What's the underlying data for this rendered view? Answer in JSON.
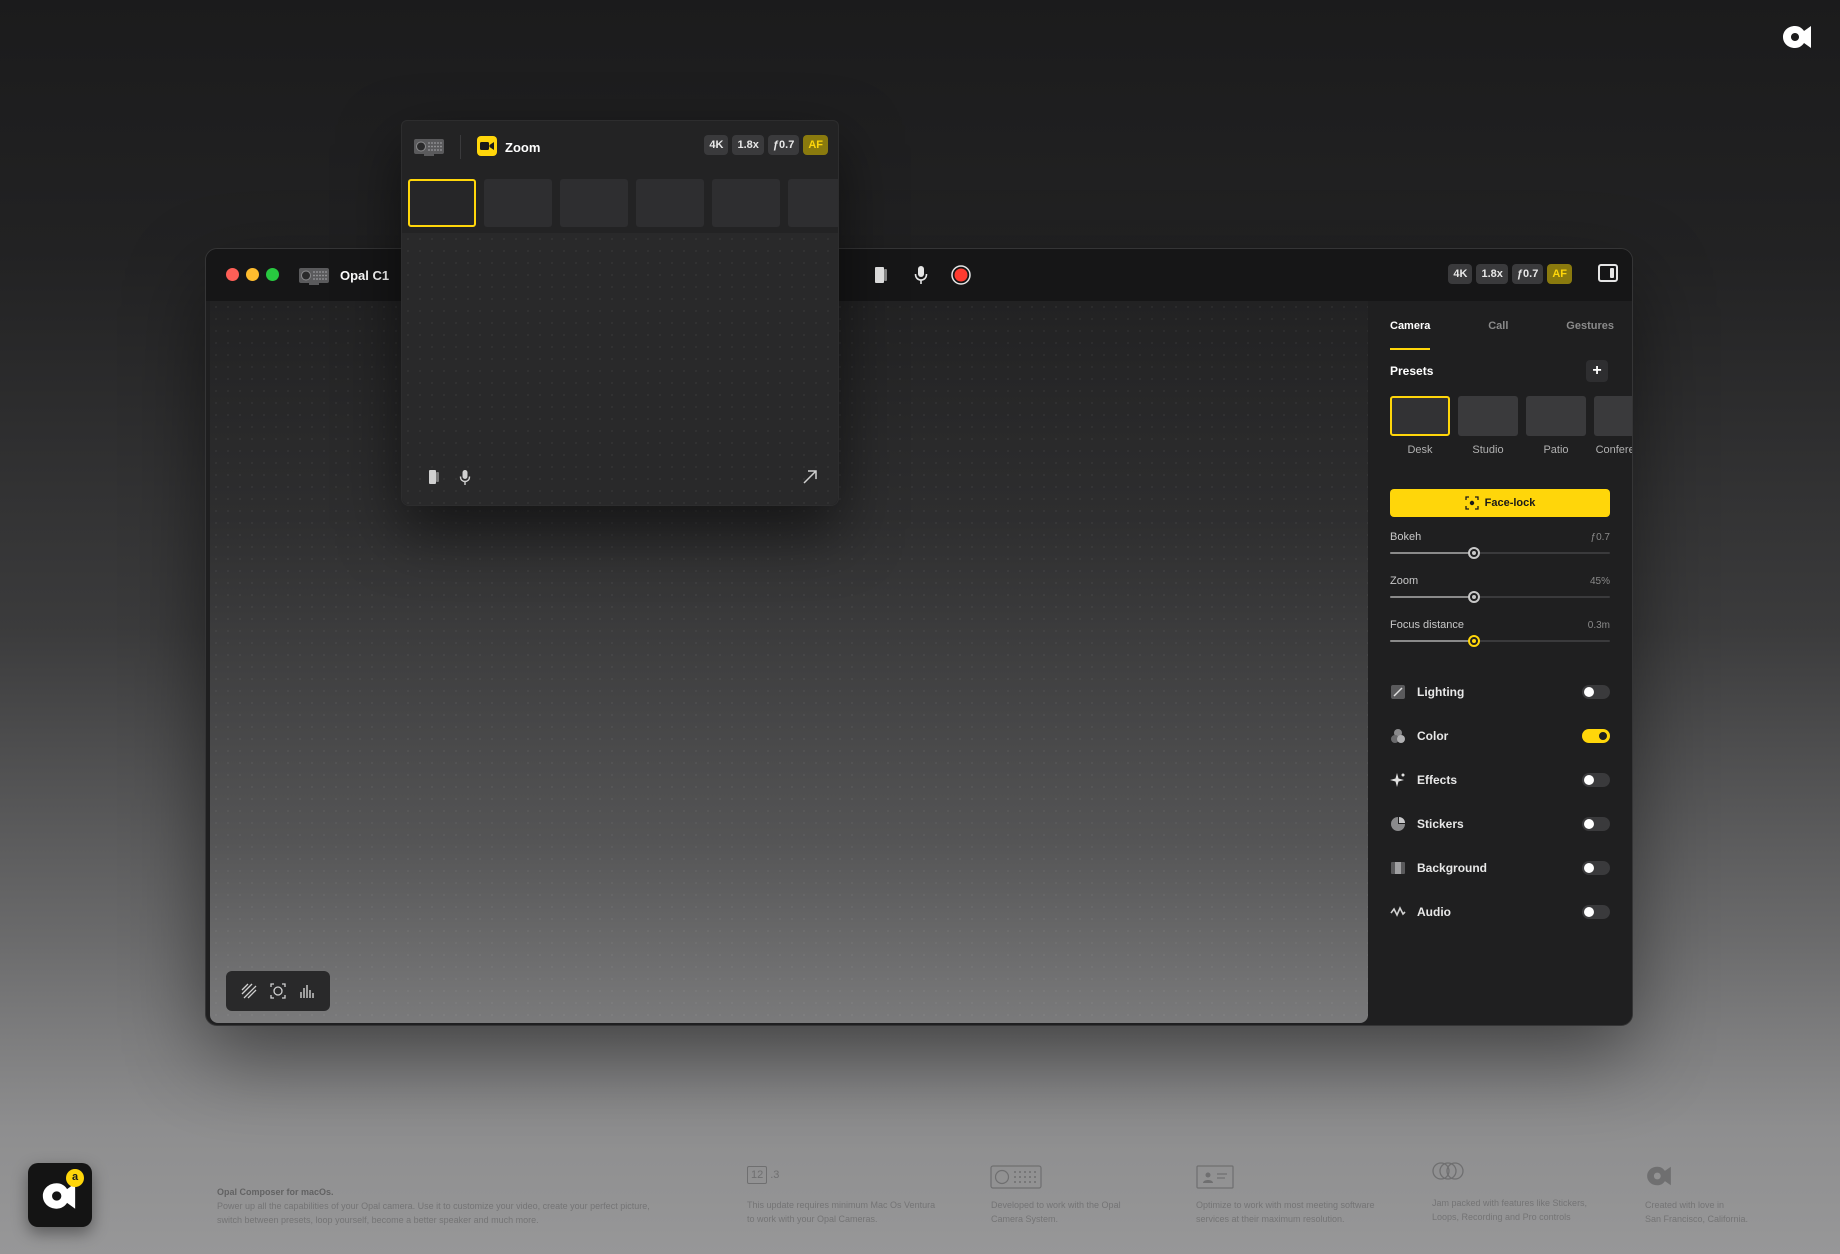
{
  "window": {
    "title": "Opal C1",
    "badges": [
      "4K",
      "1.8x",
      "ƒ0.7",
      "AF"
    ]
  },
  "popup": {
    "title": "Zoom",
    "badges": [
      "4K",
      "1.8x",
      "ƒ0.7",
      "AF"
    ],
    "preset_count": 6
  },
  "sidebar": {
    "tabs": [
      {
        "label": "Camera",
        "active": true
      },
      {
        "label": "Call",
        "active": false
      },
      {
        "label": "Gestures",
        "active": false
      }
    ],
    "presets_label": "Presets",
    "add_label": "+",
    "presets": [
      {
        "name": "Desk",
        "active": true
      },
      {
        "name": "Studio",
        "active": false
      },
      {
        "name": "Patio",
        "active": false
      },
      {
        "name": "Conference",
        "active": false
      }
    ],
    "facelock_label": "Face-lock",
    "sliders": [
      {
        "label": "Bokeh",
        "value": "ƒ0.7",
        "level": 0.38
      },
      {
        "label": "Zoom",
        "value": "45%",
        "level": 0.38
      },
      {
        "label": "Focus distance",
        "value": "0.3m",
        "level": 0.38
      }
    ],
    "toggles": [
      {
        "label": "Lighting",
        "icon": "lighting-icon",
        "on": false
      },
      {
        "label": "Color",
        "icon": "color-icon",
        "on": true
      },
      {
        "label": "Effects",
        "icon": "effects-icon",
        "on": false
      },
      {
        "label": "Stickers",
        "icon": "stickers-icon",
        "on": false
      },
      {
        "label": "Background",
        "icon": "background-icon",
        "on": false
      },
      {
        "label": "Audio",
        "icon": "audio-icon",
        "on": false
      }
    ]
  },
  "footer": {
    "app_badge": "a",
    "intro_title": "Opal Composer for macOs.",
    "intro_text_1": "Power up all the capabilities of your Opal camera. Use it to customize your video, create your perfect picture,",
    "intro_text_2": "switch between presets, loop yourself, become a better speaker and much more.",
    "version_major": "12",
    "version_minor": ".3",
    "col1_1": "This update requires minimum Mac Os Ventura",
    "col1_2": "to work with your Opal Cameras.",
    "col2_1": "Developed to work with the Opal",
    "col2_2": "Camera System.",
    "col3_1": "Optimize to work with most meeting software",
    "col3_2": "services at their maximum resolution.",
    "col4_1": "Jam packed with features like Stickers,",
    "col4_2": "Loops, Recording and Pro controls",
    "col5_1": "Created with love in",
    "col5_2": "San Francisco, California."
  },
  "colors": {
    "accent": "#ffd60a",
    "record": "#ff3b30",
    "window_bg": "#1f1f20"
  }
}
